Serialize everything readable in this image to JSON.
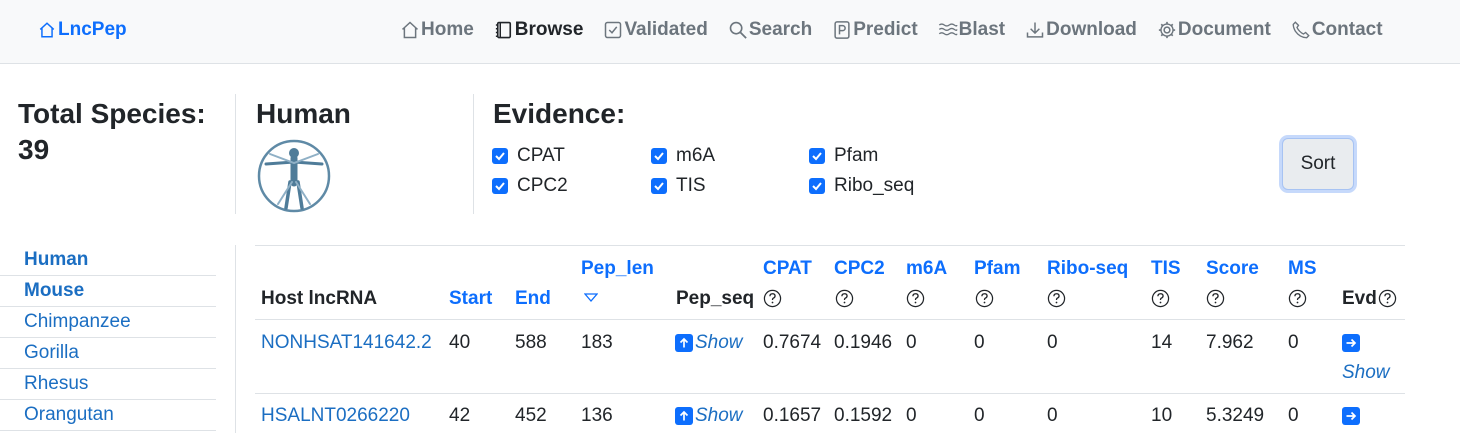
{
  "nav": {
    "brand": "LncPep",
    "items": [
      "Home",
      "Browse",
      "Validated",
      "Search",
      "Predict",
      "Blast",
      "Download",
      "Document",
      "Contact"
    ],
    "active": "Browse",
    "icons": [
      "home-icon",
      "book-icon",
      "check-square-icon",
      "search-icon",
      "p-square-icon",
      "wave-icon",
      "download-icon",
      "gear-icon",
      "phone-icon"
    ]
  },
  "summary": {
    "total_label": "Total Species:",
    "total_value": "39",
    "species": "Human",
    "evidence_label": "Evidence:",
    "evidence": [
      {
        "label": "CPAT",
        "checked": true
      },
      {
        "label": "m6A",
        "checked": true
      },
      {
        "label": "Pfam",
        "checked": true
      },
      {
        "label": "CPC2",
        "checked": true
      },
      {
        "label": "TIS",
        "checked": true
      },
      {
        "label": "Ribo_seq",
        "checked": true
      }
    ],
    "sort_label": "Sort"
  },
  "sidebar": {
    "items": [
      {
        "label": "Human",
        "bold": true
      },
      {
        "label": "Mouse",
        "bold": true
      },
      {
        "label": "Chimpanzee",
        "bold": false
      },
      {
        "label": "Gorilla",
        "bold": false
      },
      {
        "label": "Rhesus",
        "bold": false
      },
      {
        "label": "Orangutan",
        "bold": false
      }
    ]
  },
  "table": {
    "headers": {
      "host": "Host lncRNA",
      "start": "Start",
      "end": "End",
      "pep_len": "Pep_len",
      "pep_seq": "Pep_seq",
      "cpat": "CPAT",
      "cpc2": "CPC2",
      "m6a": "m6A",
      "pfam": "Pfam",
      "ribo": "Ribo-seq",
      "tis": "TIS",
      "score": "Score",
      "ms": "MS",
      "evd": "Evd"
    },
    "show_label": "Show",
    "rows": [
      {
        "host": "NONHSAT141642.2",
        "start": "40",
        "end": "588",
        "pep_len": "183",
        "cpat": "0.7674",
        "cpc2": "0.1946",
        "m6a": "0",
        "pfam": "0",
        "ribo": "0",
        "tis": "14",
        "score": "7.962",
        "ms": "0"
      },
      {
        "host": "HSALNT0266220",
        "start": "42",
        "end": "452",
        "pep_len": "136",
        "cpat": "0.1657",
        "cpc2": "0.1592",
        "m6a": "0",
        "pfam": "0",
        "ribo": "0",
        "tis": "10",
        "score": "5.3249",
        "ms": "0"
      }
    ]
  },
  "colors": {
    "link": "#0d6efd",
    "text": "#212529",
    "muted": "#6c757d",
    "navbar_bg": "#f8f9fa"
  }
}
